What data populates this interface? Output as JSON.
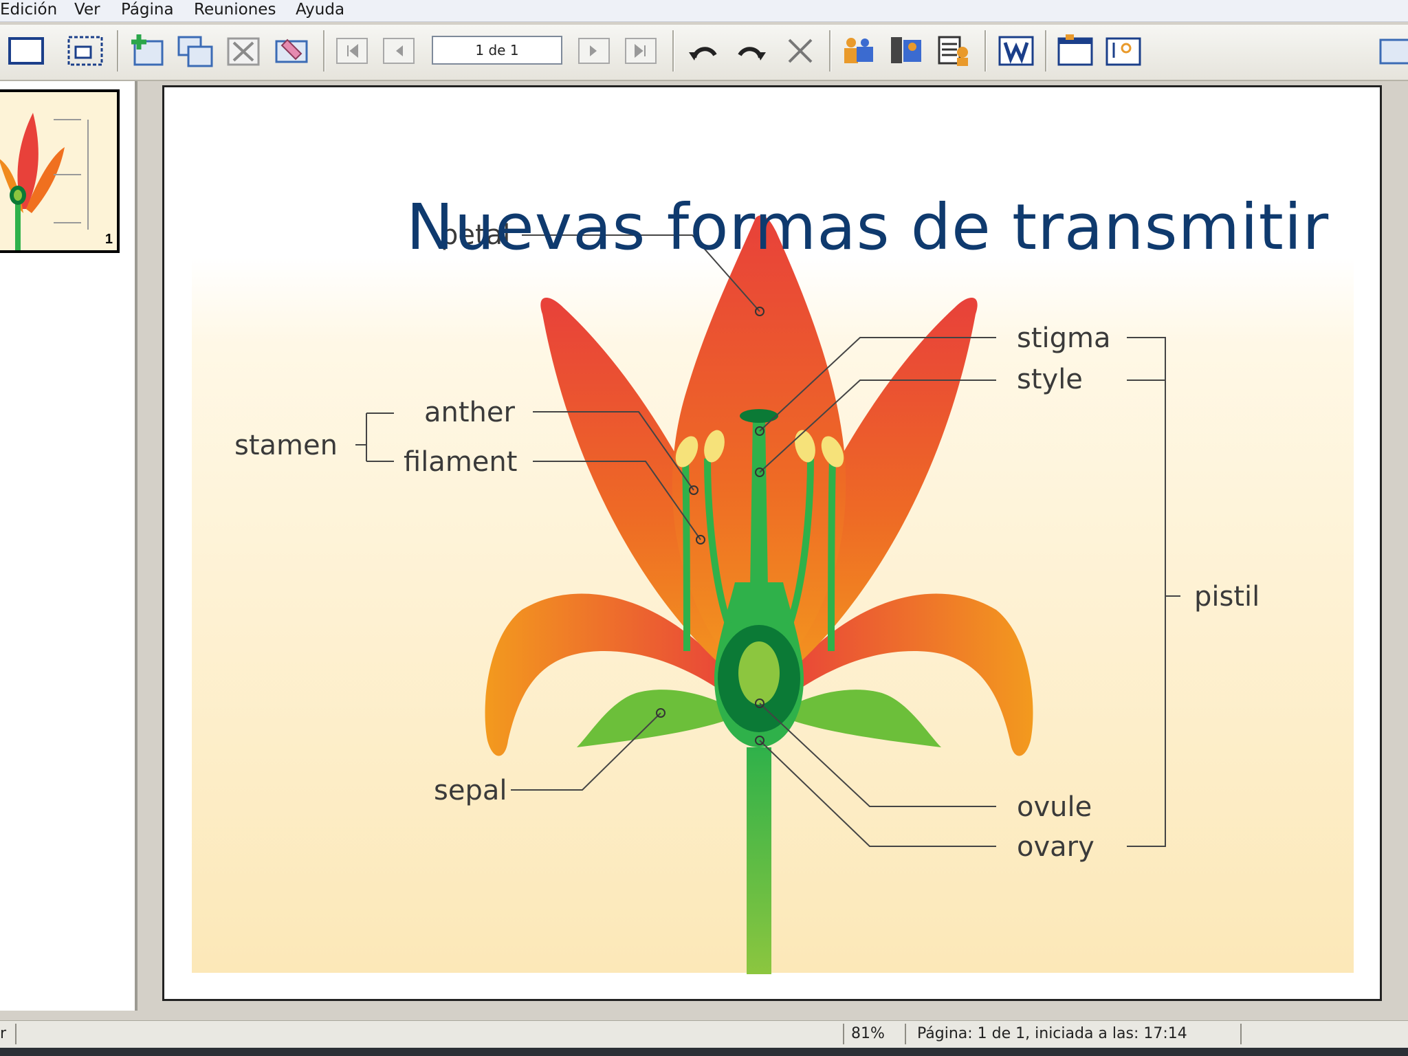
{
  "menu": {
    "items": [
      "Edición",
      "Ver",
      "Página",
      "Reuniones",
      "Ayuda"
    ]
  },
  "toolbar": {
    "page_value": "1 de 1",
    "icons": [
      "full-screen-icon",
      "fit-page-icon",
      "add-page-icon",
      "copy-page-icon",
      "delete-page-icon",
      "eraser-icon",
      "first-page-icon",
      "previous-page-icon",
      "next-page-icon",
      "last-page-icon",
      "undo-icon",
      "redo-icon",
      "clear-icon",
      "share-icon",
      "people-icon",
      "meeting-icon",
      "word-export-icon",
      "window-icon",
      "screen-capture-icon",
      "extra-icon"
    ]
  },
  "thumbnail": {
    "page_number": "1"
  },
  "slide": {
    "title": "Nuevas formas de transmitir",
    "labels": {
      "petal": "petal",
      "stamen": "stamen",
      "anther": "anther",
      "filament": "filament",
      "stigma": "stigma",
      "style": "style",
      "pistil": "pistil",
      "sepal": "sepal",
      "ovule": "ovule",
      "ovary": "ovary"
    },
    "colors": {
      "petal_red": "#e8413a",
      "petal_orange": "#f08a1d",
      "green": "#2fb14a",
      "dark_green": "#0b7a36",
      "light_green": "#8cc63f",
      "anther_yellow": "#f6e27a",
      "title_blue": "#0f3a6e"
    }
  },
  "status": {
    "left": "r",
    "zoom": "81%",
    "page_info": "Página: 1 de 1, iniciada a las: 17:14"
  }
}
